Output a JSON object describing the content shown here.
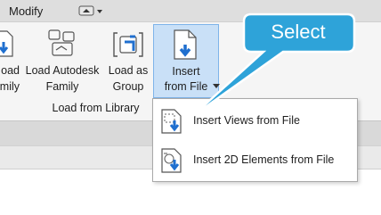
{
  "topbar": {
    "tab_label": "Modify"
  },
  "ribbon": {
    "buttons": [
      {
        "line1": "oad",
        "line2": "mily"
      },
      {
        "line1": "Load Autodesk",
        "line2": "Family"
      },
      {
        "line1": "Load as",
        "line2": "Group"
      },
      {
        "line1": "Insert",
        "line2": "from File"
      }
    ],
    "panel_label": "Load from Library"
  },
  "dropdown": {
    "items": [
      {
        "label": "Insert Views from File",
        "icon": "insert-views-icon"
      },
      {
        "label": "Insert 2D Elements from File",
        "icon": "insert-2d-elements-icon"
      }
    ]
  },
  "callout": {
    "text": "Select",
    "color": "#2ea3d9"
  },
  "colors": {
    "accent": "#2f7fd0",
    "selected_bg": "#c9e0f7",
    "selected_border": "#7eb4ea"
  }
}
